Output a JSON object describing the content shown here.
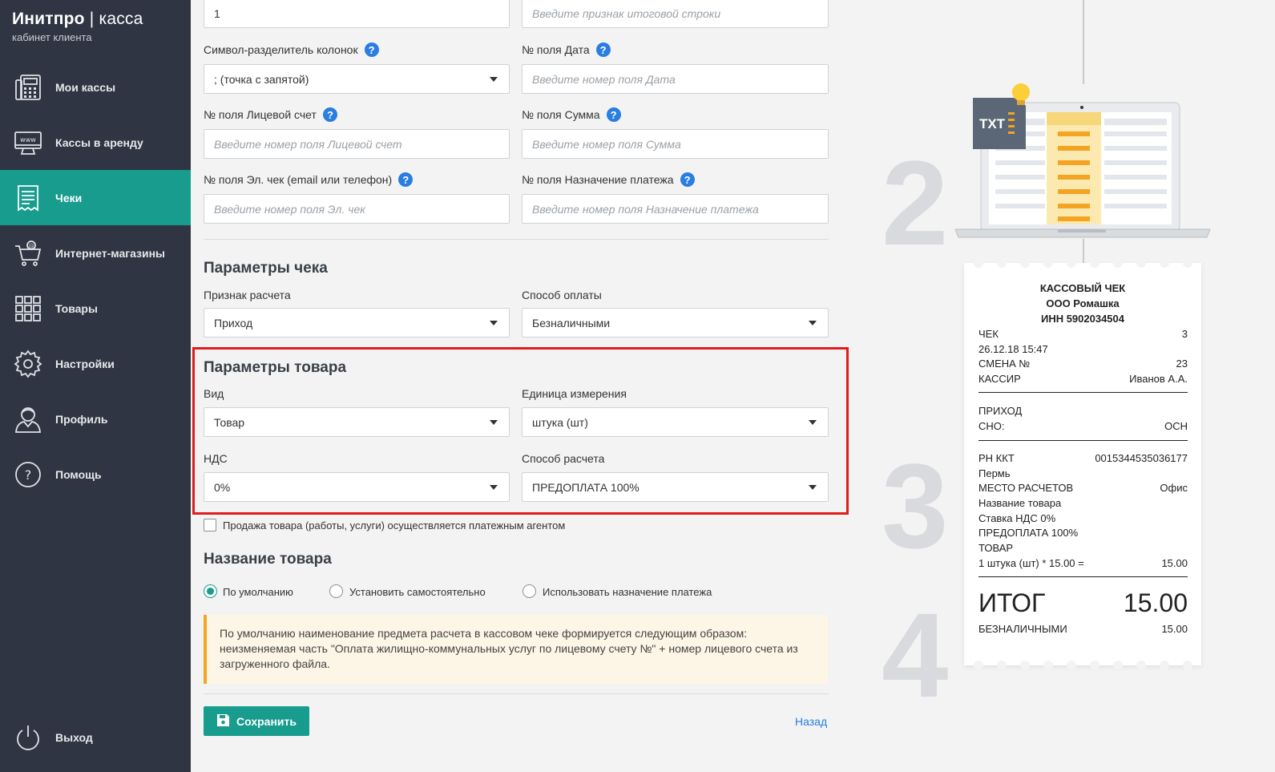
{
  "brand": {
    "title_bold": "Инитпро",
    "title_thin": "касса",
    "subtitle": "кабинет клиента"
  },
  "sidebar": {
    "items": [
      {
        "label": "Мои кассы",
        "icon": "cash-register-icon"
      },
      {
        "label": "Кассы в аренду",
        "icon": "www-terminal-icon"
      },
      {
        "label": "Чеки",
        "icon": "receipt-icon",
        "active": true
      },
      {
        "label": "Интернет-магазины",
        "icon": "shopping-cart-icon"
      },
      {
        "label": "Товары",
        "icon": "grid-icon"
      },
      {
        "label": "Настройки",
        "icon": "gear-icon"
      },
      {
        "label": "Профиль",
        "icon": "user-icon"
      },
      {
        "label": "Помощь",
        "icon": "question-icon"
      }
    ],
    "logout": {
      "label": "Выход",
      "icon": "power-icon"
    }
  },
  "form": {
    "top_input_value": "1",
    "total_row_placeholder": "Введите признак итоговой строки",
    "separator": {
      "label": "Символ-разделитель колонок",
      "value": "; (точка с запятой)"
    },
    "date_field": {
      "label": "№ поля Дата",
      "placeholder": "Введите номер поля Дата"
    },
    "account_field": {
      "label": "№ поля Лицевой счет",
      "placeholder": "Введите номер поля Лицевой счет"
    },
    "sum_field": {
      "label": "№ поля Сумма",
      "placeholder": "Введите номер поля Сумма"
    },
    "email_field": {
      "label": "№ поля Эл. чек (email или телефон)",
      "placeholder": "Введите номер поля Эл. чек"
    },
    "purpose_field": {
      "label": "№ поля Назначение платежа",
      "placeholder": "Введите номер поля Назначение платежа"
    },
    "help_glyph": "?"
  },
  "receipt_params": {
    "title": "Параметры чека",
    "calc_sign": {
      "label": "Признак расчета",
      "value": "Приход"
    },
    "payment_method": {
      "label": "Способ оплаты",
      "value": "Безналичными"
    }
  },
  "product_params": {
    "title": "Параметры товара",
    "kind": {
      "label": "Вид",
      "value": "Товар"
    },
    "unit": {
      "label": "Единица измерения",
      "value": "штука (шт)"
    },
    "vat": {
      "label": "НДС",
      "value": "0%"
    },
    "calc_method": {
      "label": "Способ расчета",
      "value": "ПРЕДОПЛАТА 100%"
    }
  },
  "agent_checkbox": {
    "label": "Продажа товара (работы, услуги) осуществляется платежным агентом",
    "checked": false
  },
  "product_name": {
    "title": "Название товара",
    "options": [
      {
        "label": "По умолчанию",
        "selected": true
      },
      {
        "label": "Установить самостоятельно",
        "selected": false
      },
      {
        "label": "Использовать назначение платежа",
        "selected": false
      }
    ],
    "note": "По умолчанию наименование предмета расчета в кассовом чеке формируется следующим образом: неизменяемая часть \"Оплата жилищно-коммунальных услуг по лицевому счету №\" + номер лицевого счета из загруженного файла."
  },
  "actions": {
    "save": "Сохранить",
    "back": "Назад"
  },
  "illustration": {
    "steps": [
      "2",
      "3",
      "4"
    ],
    "file_badge": "TXT"
  },
  "receipt": {
    "header": [
      "КАССОВЫЙ ЧЕК",
      "ООО Ромашка",
      "ИНН 5902034504"
    ],
    "rows1": [
      {
        "l": "ЧЕК",
        "r": "3"
      },
      {
        "l": "26.12.18 15:47",
        "r": ""
      },
      {
        "l": "СМЕНА №",
        "r": "23"
      },
      {
        "l": "КАССИР",
        "r": "Иванов А.А."
      }
    ],
    "rows2": [
      {
        "l": "ПРИХОД",
        "r": ""
      },
      {
        "l": "СНО:",
        "r": "ОСН"
      }
    ],
    "rows3": [
      {
        "l": "РН ККТ",
        "r": "0015344535036177"
      },
      {
        "l": "Пермь",
        "r": ""
      },
      {
        "l": "МЕСТО РАСЧЕТОВ",
        "r": "Офис"
      },
      {
        "l": "Название товара",
        "r": ""
      },
      {
        "l": "Ставка НДС 0%",
        "r": ""
      },
      {
        "l": "ПРЕДОПЛАТА 100%",
        "r": ""
      },
      {
        "l": "ТОВАР",
        "r": ""
      },
      {
        "l": "1 штука (шт) * 15.00 =",
        "r": "15.00"
      }
    ],
    "total_label": "ИТОГ",
    "total_value": "15.00",
    "noncash_label": "БЕЗНАЛИЧНЫМИ",
    "noncash_value": "15.00"
  },
  "colors": {
    "accent": "#179c8d",
    "sidebar": "#2f3542",
    "highlight": "#e01b1b",
    "link": "#2a7de1"
  }
}
